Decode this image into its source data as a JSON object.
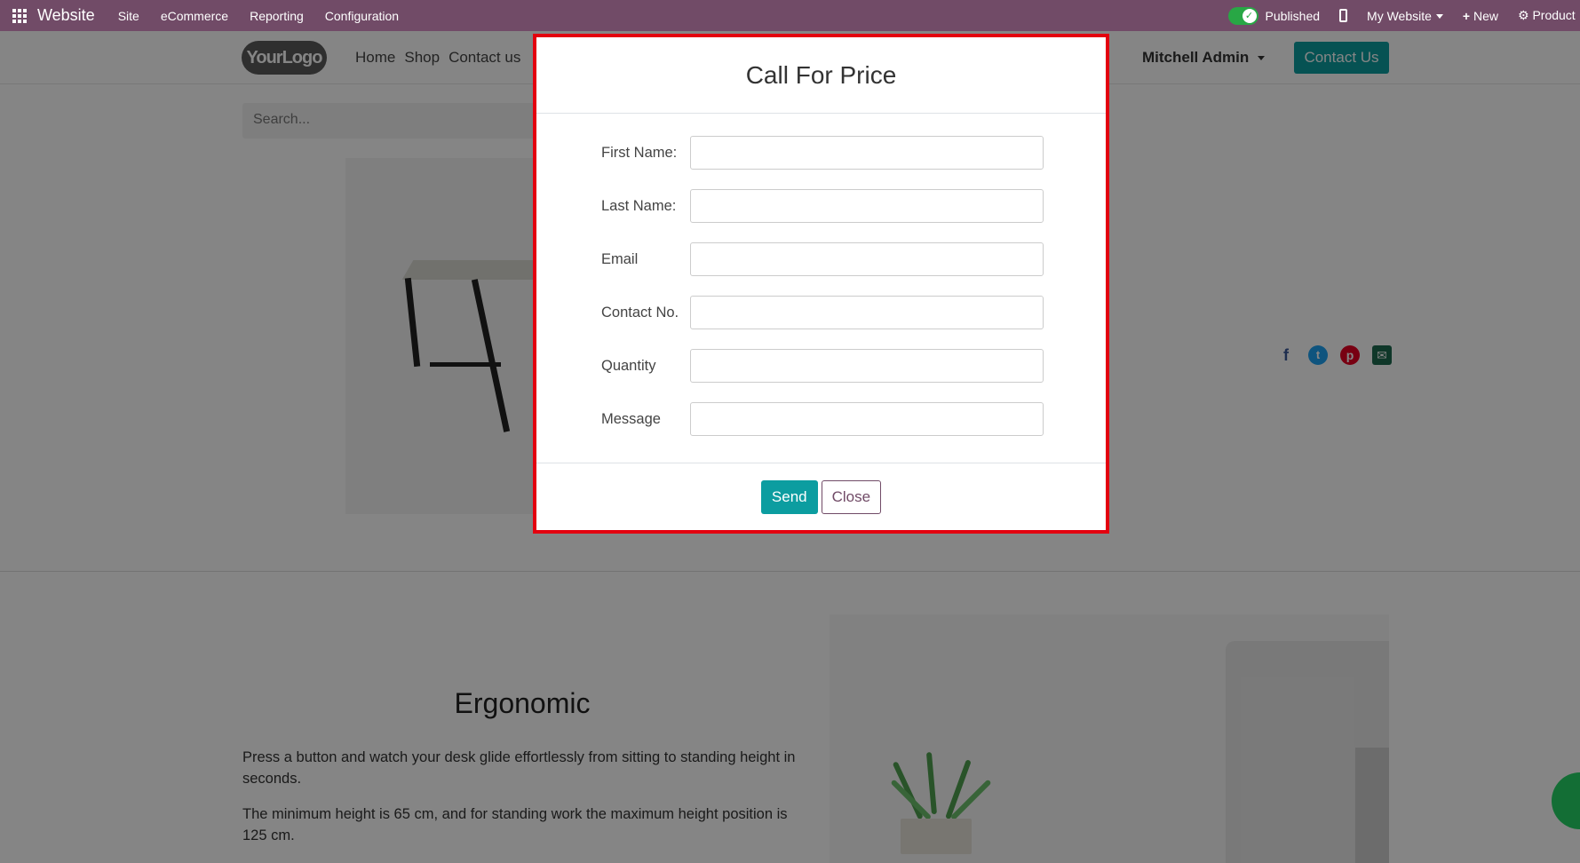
{
  "topbar": {
    "brand": "Website",
    "menus": [
      "Site",
      "eCommerce",
      "Reporting",
      "Configuration"
    ],
    "published_label": "Published",
    "website_label": "My Website",
    "new_label": "New",
    "product_label": "Product"
  },
  "site": {
    "logo_text": "YourLogo",
    "nav": [
      "Home",
      "Shop",
      "Contact us"
    ],
    "user_name": "Mitchell Admin",
    "contact_button": "Contact Us",
    "search_placeholder": "Search...",
    "section_title": "Ergonomic",
    "paragraph_1": "Press a button and watch your desk glide effortlessly from sitting to standing height in seconds.",
    "paragraph_2": "The minimum height is 65 cm, and for standing work the maximum height position is 125 cm."
  },
  "modal": {
    "title": "Call For Price",
    "fields": [
      {
        "label": "First Name:",
        "value": ""
      },
      {
        "label": "Last Name:",
        "value": ""
      },
      {
        "label": "Email",
        "value": ""
      },
      {
        "label": "Contact No.",
        "value": ""
      },
      {
        "label": "Quantity",
        "value": ""
      },
      {
        "label": "Message",
        "value": ""
      }
    ],
    "send_label": "Send",
    "close_label": "Close"
  },
  "colors": {
    "topbar": "#714b67",
    "accent": "#0c9da0",
    "modal_highlight": "#e3000f"
  },
  "icons": [
    "apps-grid-icon",
    "toggle-published-icon",
    "mobile-preview-icon",
    "plus-icon",
    "gear-icon",
    "facebook-icon",
    "twitter-icon",
    "pinterest-icon",
    "envelope-icon",
    "whatsapp-icon"
  ]
}
